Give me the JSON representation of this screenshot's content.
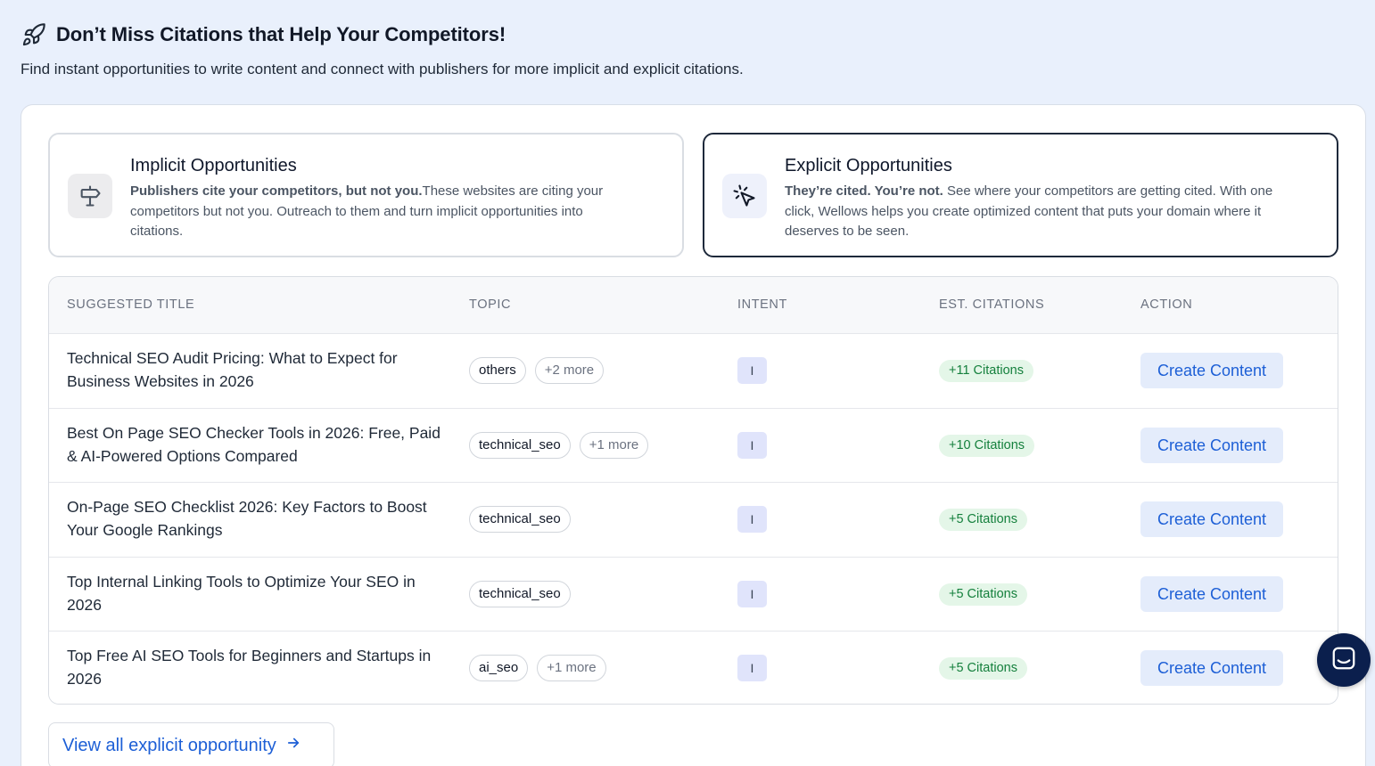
{
  "header": {
    "title": "Don’t Miss Citations that Help Your Competitors!",
    "subtitle": "Find instant opportunities to write content and connect with publishers for more implicit and explicit citations.",
    "icon": "rocket-icon"
  },
  "cards": {
    "implicit": {
      "title": "Implicit Opportunities",
      "bold": "Publishers cite your competitors, but not you.",
      "desc": "These websites are citing your competitors but not you. Outreach to them and turn implicit opportunities into citations.",
      "icon": "signpost-icon"
    },
    "explicit": {
      "title": "Explicit Opportunities",
      "bold": "They’re cited. You’re not.",
      "desc": " See where your competitors are getting cited. With one click, Wellows helps you create optimized content that puts your domain where it deserves to be seen.",
      "icon": "cursor-click-icon",
      "selected": true
    }
  },
  "table": {
    "headers": {
      "title": "SUGGESTED TITLE",
      "topic": "TOPIC",
      "intent": "INTENT",
      "citations": "EST. CITATIONS",
      "action": "ACTION"
    },
    "rows": [
      {
        "title": "Technical SEO Audit Pricing: What to Expect for Business Websites in 2026",
        "topic": "others",
        "more": "+2 more",
        "intent": "I",
        "citations": "+11 Citations",
        "action": "Create Content"
      },
      {
        "title": "Best On Page SEO Checker Tools in 2026: Free, Paid & AI-Powered Options Compared",
        "topic": "technical_seo",
        "more": "+1 more",
        "intent": "I",
        "citations": "+10 Citations",
        "action": "Create Content"
      },
      {
        "title": "On-Page SEO Checklist 2026: Key Factors to Boost Your Google Rankings",
        "topic": "technical_seo",
        "more": "",
        "intent": "I",
        "citations": "+5 Citations",
        "action": "Create Content"
      },
      {
        "title": "Top Internal Linking Tools to Optimize Your SEO in 2026",
        "topic": "technical_seo",
        "more": "",
        "intent": "I",
        "citations": "+5 Citations",
        "action": "Create Content"
      },
      {
        "title": "Top Free AI SEO Tools for Beginners and Startups in 2026",
        "topic": "ai_seo",
        "more": "+1 more",
        "intent": "I",
        "citations": "+5 Citations",
        "action": "Create Content"
      }
    ]
  },
  "view_all": {
    "label": "View all explicit opportunity",
    "icon": "arrow-right-icon"
  },
  "chat": {
    "icon": "chat-icon"
  },
  "colors": {
    "accent": "#1d5fd6",
    "citation_green": "#15803d",
    "chat_bg": "#0b1f4d"
  }
}
